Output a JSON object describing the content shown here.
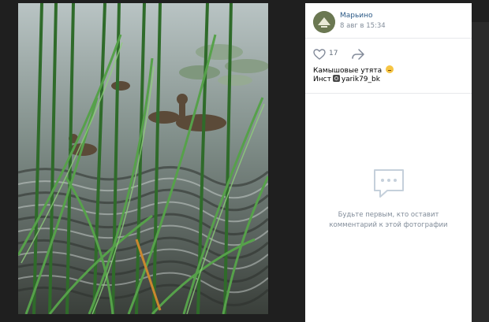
{
  "post": {
    "author": "Марьино",
    "date": "8 авг в 15:34",
    "likes": "17",
    "caption": "Камышовые утята",
    "inst_prefix": "Инст",
    "inst_handle": "yarik79_bk"
  },
  "comments": {
    "empty_line1": "Будьте первым, кто оставит",
    "empty_line2": "комментарий к этой фотографии"
  },
  "colors": {
    "link": "#2a5885",
    "muted": "#818c99",
    "background": "#1f1f1f"
  },
  "icons": [
    "heart-icon",
    "share-arrow-icon",
    "comment-bubble-icon",
    "smile-emoji-icon",
    "instagram-icon"
  ]
}
